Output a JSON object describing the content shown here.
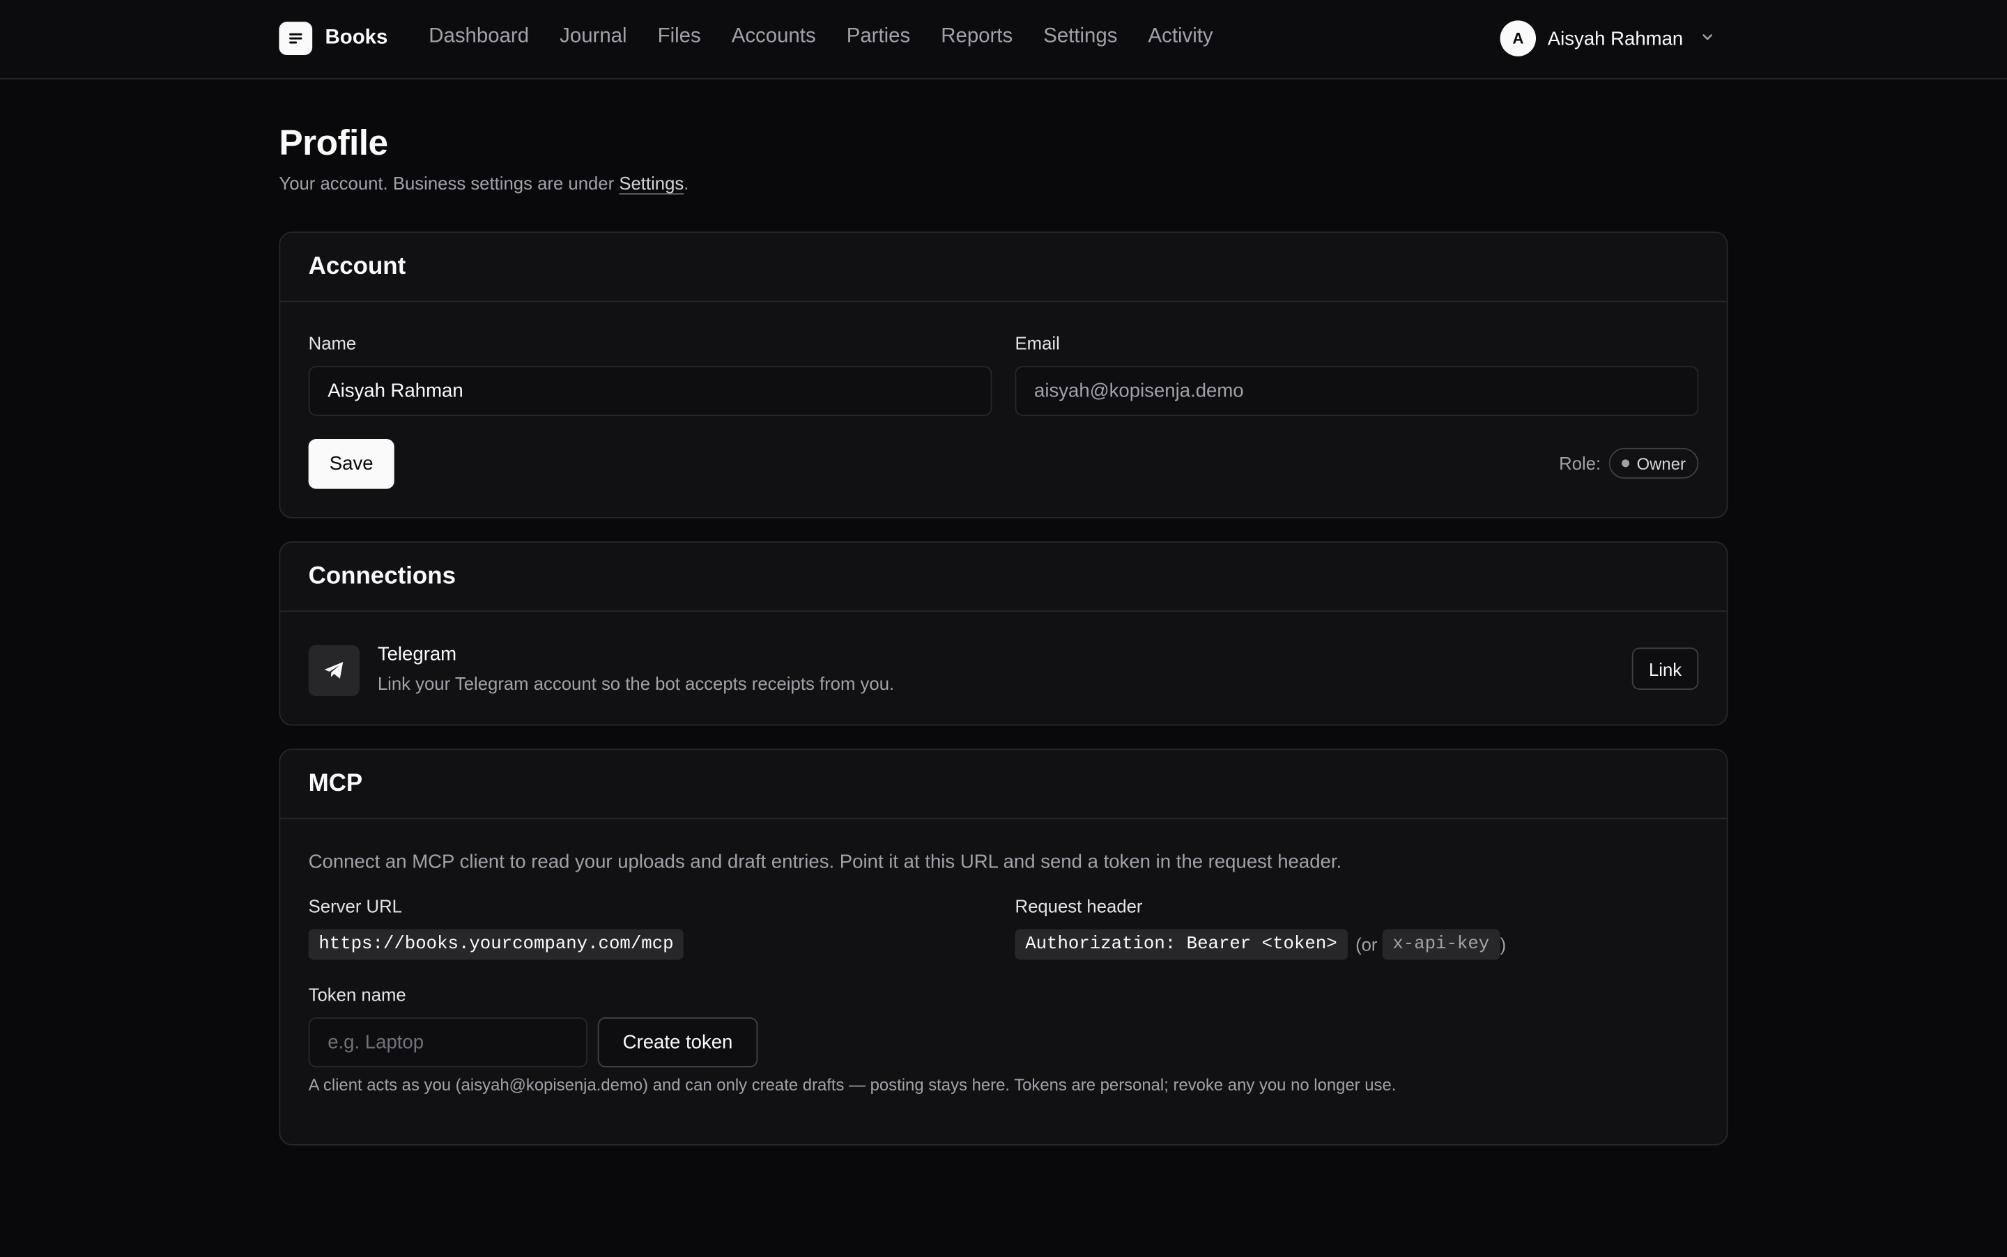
{
  "app": {
    "brand": "Books",
    "logo_icon": "document-lines-icon"
  },
  "nav": {
    "items": [
      {
        "label": "Dashboard"
      },
      {
        "label": "Journal"
      },
      {
        "label": "Files"
      },
      {
        "label": "Accounts"
      },
      {
        "label": "Parties"
      },
      {
        "label": "Reports"
      },
      {
        "label": "Settings"
      },
      {
        "label": "Activity"
      }
    ]
  },
  "user": {
    "initial": "A",
    "name": "Aisyah Rahman"
  },
  "header": {
    "title": "Profile",
    "subtitle_before": "Your account. Business settings are under ",
    "subtitle_link": "Settings",
    "subtitle_after": "."
  },
  "account": {
    "title": "Account",
    "name_label": "Name",
    "name_value": "Aisyah Rahman",
    "email_label": "Email",
    "email_value": "aisyah@kopisenja.demo",
    "save_label": "Save",
    "role_label": "Role:",
    "role_value": "Owner"
  },
  "connections": {
    "title": "Connections",
    "telegram_title": "Telegram",
    "telegram_desc": "Link your Telegram account so the bot accepts receipts from you.",
    "link_label": "Link"
  },
  "mcp": {
    "title": "MCP",
    "intro": "Connect an MCP client to read your uploads and draft entries. Point it at this URL and send a token in the request header.",
    "server_url_label": "Server URL",
    "server_url": "https://books.yourcompany.com/mcp",
    "request_header_label": "Request header",
    "request_header": "Authorization: Bearer <token>",
    "alt_open": "(or",
    "alt_header": "x-api-key",
    "alt_close": ")",
    "token_name_label": "Token name",
    "token_name_placeholder": "e.g. Laptop",
    "create_token_label": "Create token",
    "footnote": "A client acts as you (aisyah@kopisenja.demo) and can only create drafts — posting stays here. Tokens are personal; revoke any you no longer use."
  }
}
